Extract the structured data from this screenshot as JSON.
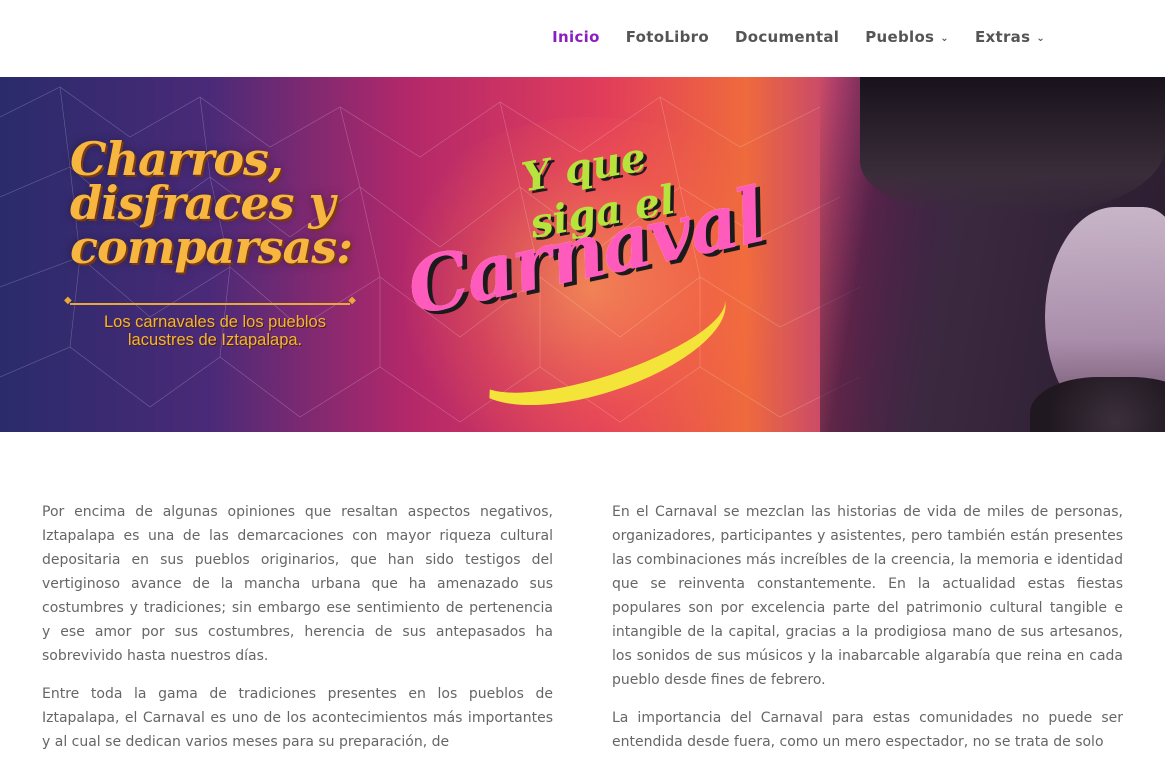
{
  "nav": {
    "items": [
      {
        "label": "Inicio",
        "active": true,
        "dropdown": false
      },
      {
        "label": "FotoLibro",
        "active": false,
        "dropdown": false
      },
      {
        "label": "Documental",
        "active": false,
        "dropdown": false
      },
      {
        "label": "Pueblos",
        "active": false,
        "dropdown": true
      },
      {
        "label": "Extras",
        "active": false,
        "dropdown": true
      }
    ]
  },
  "hero": {
    "title_lines": [
      "Charros,",
      "disfraces y",
      "comparsas:"
    ],
    "subtitle_lines": [
      "Los carnavales de los pueblos",
      "lacustres de Iztapalapa."
    ],
    "logo_top": "Y que siga el",
    "logo_main": "Carnaval"
  },
  "content": {
    "left": [
      "Por encima de algunas opiniones que resaltan aspectos negativos, Iztapalapa es una de las demarcaciones con mayor riqueza cultural depositaria en sus pueblos originarios, que han sido testigos del vertiginoso avance de la mancha urbana que ha amenazado sus costumbres y tradiciones; sin embargo ese sentimiento de pertenencia y ese amor por sus costumbres, herencia de sus antepasados ha sobrevivido hasta nuestros días.",
      "Entre toda la gama de tradiciones presentes en los pueblos de Iztapalapa, el Carnaval es uno de los acontecimientos más importantes y al cual se dedican varios meses para su preparación, de"
    ],
    "right": [
      "En el Carnaval se mezclan las historias de vida de miles de personas, organizadores, participantes y asistentes, pero también están presentes las combinaciones más increíbles de la creencia, la memoria e identidad que se reinventa constantemente. En la actualidad estas fiestas populares son por excelencia parte del patrimonio cultural tangible e intangible de la capital, gracias a la prodigiosa mano de sus artesanos, los sonidos de sus músicos y la inabarcable algarabía que reina en cada pueblo desde fines de febrero.",
      "La importancia del Carnaval para estas comunidades no puede ser entendida desde fuera, como un mero espectador, no se trata de solo"
    ]
  },
  "colors": {
    "active_nav": "#8a1ec1",
    "nav_text": "#555555",
    "body_text": "#666666",
    "title_gold": "#f7b640",
    "logo_pink": "#ff5bbd",
    "logo_green": "#b7e43c"
  }
}
